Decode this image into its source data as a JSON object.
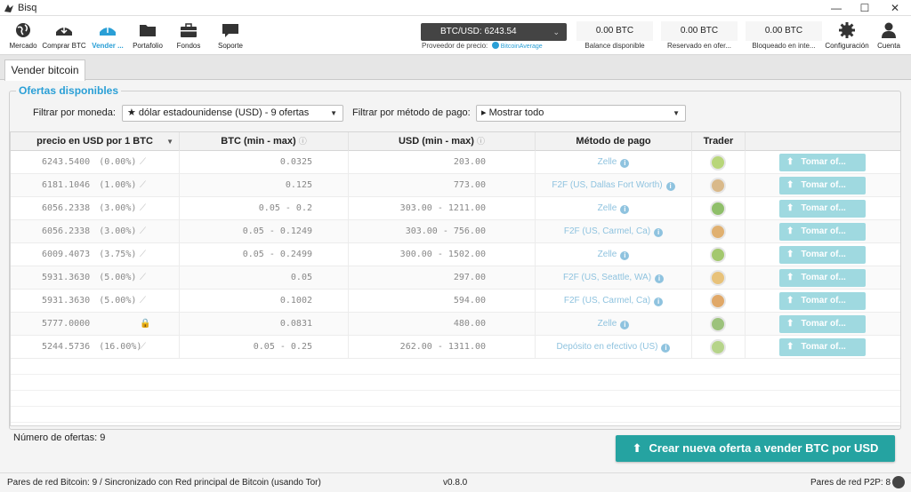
{
  "window": {
    "title": "Bisq",
    "minimize": "—",
    "maximize": "☐",
    "close": "✕"
  },
  "nav": [
    {
      "label": "Mercado",
      "icon": "globe-icon"
    },
    {
      "label": "Comprar BTC",
      "icon": "buy-bitcoin-icon"
    },
    {
      "label": "Vender ...",
      "icon": "sell-bitcoin-icon"
    },
    {
      "label": "Portafolio",
      "icon": "folder-icon"
    },
    {
      "label": "Fondos",
      "icon": "briefcase-icon"
    },
    {
      "label": "Soporte",
      "icon": "chat-icon"
    }
  ],
  "price": {
    "label": "BTC/USD: 6243.54",
    "provider_label": "Proveedor de precio:",
    "provider_name": "BitcoinAverage"
  },
  "balances": [
    {
      "value": "0.00 BTC",
      "caption": "Balance disponible"
    },
    {
      "value": "0.00 BTC",
      "caption": "Reservado en ofer..."
    },
    {
      "value": "0.00 BTC",
      "caption": "Bloqueado en inte..."
    }
  ],
  "settings_label": "Configuración",
  "account_label": "Cuenta",
  "tab": {
    "label": "Vender bitcoin"
  },
  "offers": {
    "title": "Ofertas disponibles",
    "currency_filter_label": "Filtrar por moneda:",
    "currency_filter_value": "★ dólar estadounidense (USD) - 9 ofertas",
    "payment_filter_label": "Filtrar por método de pago:",
    "payment_filter_value": "▸ Mostrar todo",
    "columns": {
      "price": "precio en USD por 1 BTC",
      "btc": "BTC (min - max)",
      "usd": "USD (min - max)",
      "method": "Método de pago",
      "trader": "Trader"
    },
    "rows": [
      {
        "price": "6243.5400",
        "pct": "(0.00%)",
        "btc": "0.0325",
        "usd": "203.00",
        "method": "Zelle",
        "take": "Tomar of...",
        "avatar_color": "#b8d67a"
      },
      {
        "price": "6181.1046",
        "pct": "(1.00%)",
        "btc": "0.125",
        "usd": "773.00",
        "method": "F2F (US, Dallas Fort Worth)",
        "take": "Tomar of...",
        "avatar_color": "#d9b98a"
      },
      {
        "price": "6056.2338",
        "pct": "(3.00%)",
        "btc": "0.05 - 0.2",
        "usd": "303.00 - 1211.00",
        "method": "Zelle",
        "take": "Tomar of...",
        "avatar_color": "#8fbf6a"
      },
      {
        "price": "6056.2338",
        "pct": "(3.00%)",
        "btc": "0.05 - 0.1249",
        "usd": "303.00 - 756.00",
        "method": "F2F (US, Carmel, Ca)",
        "take": "Tomar of...",
        "avatar_color": "#e0b070"
      },
      {
        "price": "6009.4073",
        "pct": "(3.75%)",
        "btc": "0.05 - 0.2499",
        "usd": "300.00 - 1502.00",
        "method": "Zelle",
        "take": "Tomar of...",
        "avatar_color": "#a3c86e"
      },
      {
        "price": "5931.3630",
        "pct": "(5.00%)",
        "btc": "0.05",
        "usd": "297.00",
        "method": "F2F (US, Seattle, WA)",
        "take": "Tomar of...",
        "avatar_color": "#e8c27a"
      },
      {
        "price": "5931.3630",
        "pct": "(5.00%)",
        "btc": "0.1002",
        "usd": "594.00",
        "method": "F2F (US, Carmel, Ca)",
        "take": "Tomar of...",
        "avatar_color": "#e0a868"
      },
      {
        "price": "5777.0000",
        "pct": "",
        "btc": "0.0831",
        "usd": "480.00",
        "method": "Zelle",
        "take": "Tomar of...",
        "avatar_color": "#9cc27c",
        "locked": true
      },
      {
        "price": "5244.5736",
        "pct": "(16.00%)",
        "btc": "0.05 - 0.25",
        "usd": "262.00 - 1311.00",
        "method": "Depósito en efectivo (US)",
        "take": "Tomar of...",
        "avatar_color": "#b6d48a"
      }
    ],
    "count_label": "Número de ofertas: 9",
    "create_button": "Crear nueva oferta a vender BTC por USD"
  },
  "status": {
    "left": "Pares de red Bitcoin: 9 / Sincronizado con Red principal de Bitcoin (usando Tor)",
    "version": "v0.8.0",
    "right": "Pares de red P2P: 8"
  },
  "colors": {
    "accent": "#2a9fd6",
    "create": "#25a3a1",
    "take": "#9fd9e0"
  }
}
